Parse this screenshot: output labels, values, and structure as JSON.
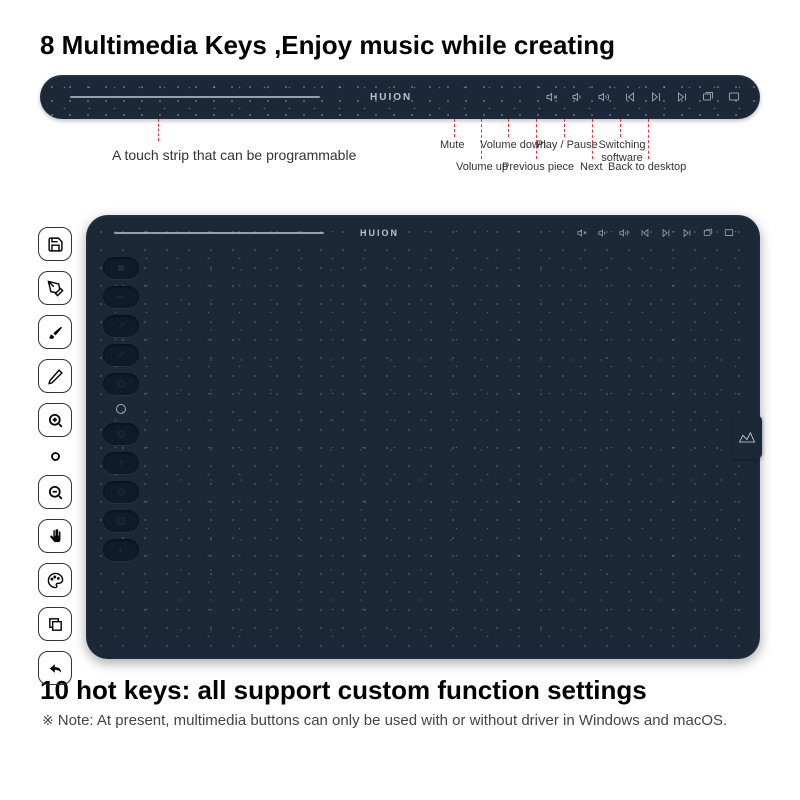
{
  "heading1": "8 Multimedia Keys ,Enjoy music while creating",
  "brand": "HUION",
  "touchstrip_label": "A touch strip that can be programmable",
  "multimedia_keys": [
    {
      "name": "mute-icon",
      "label": "Mute"
    },
    {
      "name": "volume-up-icon",
      "label": "Volume up"
    },
    {
      "name": "volume-down-icon",
      "label": "Volume down"
    },
    {
      "name": "prev-track-icon",
      "label": "Previous piece"
    },
    {
      "name": "play-pause-icon",
      "label": "Play / Pause"
    },
    {
      "name": "next-track-icon",
      "label": "Next"
    },
    {
      "name": "switch-software-icon",
      "label": "Switching software"
    },
    {
      "name": "back-desktop-icon",
      "label": "Back to desktop"
    }
  ],
  "side_icons": [
    {
      "name": "save-icon"
    },
    {
      "name": "pen-icon"
    },
    {
      "name": "brush-icon"
    },
    {
      "name": "pencil-icon"
    },
    {
      "name": "zoom-in-icon"
    },
    {
      "name": "ring-icon"
    },
    {
      "name": "zoom-out-icon"
    },
    {
      "name": "hand-icon"
    },
    {
      "name": "palette-icon"
    },
    {
      "name": "layers-icon"
    },
    {
      "name": "undo-icon"
    }
  ],
  "heading2": "10 hot keys: all support custom function settings",
  "note_symbol": "※",
  "note_text": "Note: At present, multimedia buttons can only be used with or without driver in Windows and macOS."
}
